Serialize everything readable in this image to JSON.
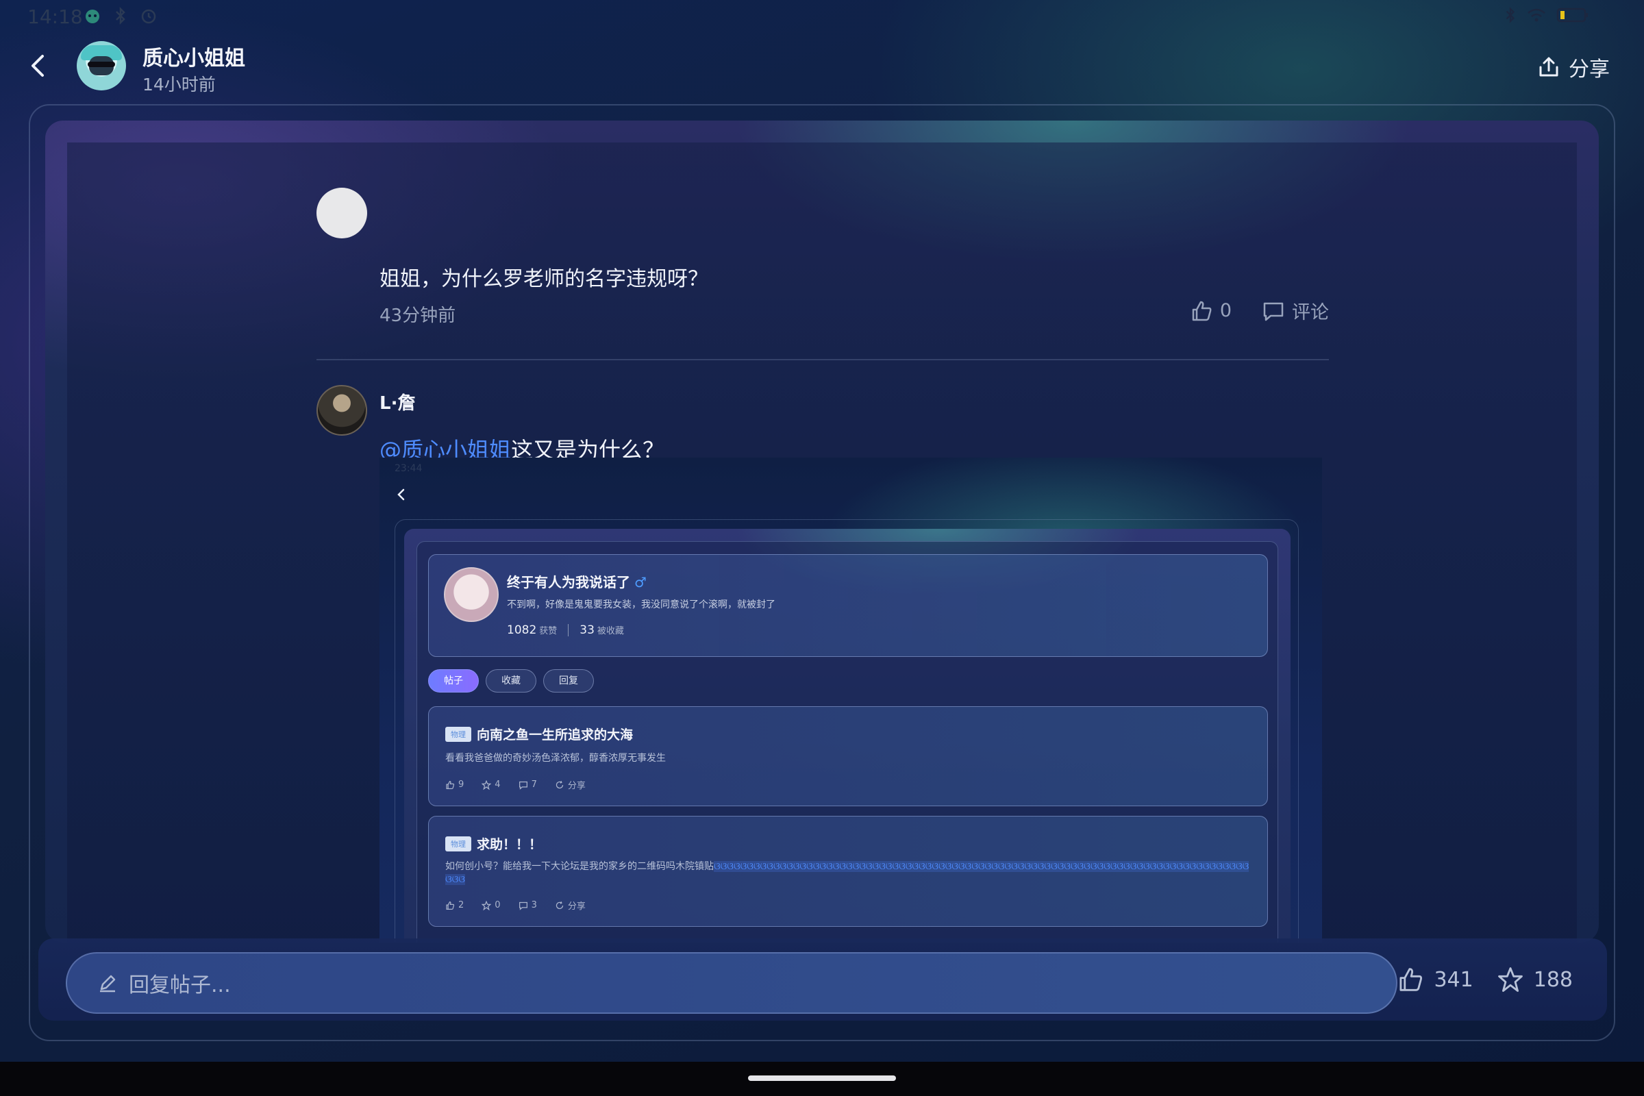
{
  "status_bar": {
    "time": "14:18"
  },
  "header": {
    "author_name": "质心小姐姐",
    "post_time": "14小时前",
    "share_label": "分享"
  },
  "comments": [
    {
      "text": "姐姐，为什么罗老师的名字违规呀？",
      "time": "43分钟前",
      "like_count": "0",
      "comment_label": "评论"
    },
    {
      "author": "L·詹",
      "mention": "@质心小姐姐",
      "text": "这又是为什么？"
    }
  ],
  "embedded_screenshot": {
    "status_time": "23:44",
    "profile": {
      "name": "终于有人为我说话了",
      "gender_symbol": "♂",
      "bio": "不到啊，好像是鬼鬼要我女装，我没同意说了个滚啊，就被封了",
      "likes_count": "1082",
      "likes_label": "获赞",
      "favorites_count": "33",
      "favorites_label": "被收藏"
    },
    "tabs": [
      "帖子",
      "收藏",
      "回复"
    ],
    "posts": [
      {
        "tag": "物理",
        "title": "向南之鱼一生所追求的大海",
        "body": "看看我爸爸做的奇妙汤色泽浓郁，醇香浓厚无事发生",
        "likes": "9",
        "stars": "4",
        "comments": "7",
        "share_label": "分享"
      },
      {
        "tag": "物理",
        "title": "求助！！！",
        "body": "如何创小号？能给我一下大论坛是我的家乡的二维码吗木院镇贴",
        "body_highlight": "ଓଓଓଓଓଓଓଓଓଓଓଓଓଓଓଓଓଓଓଓଓଓଓଓଓଓଓଓଓଓଓଓଓଓଓଓଓଓଓଓଓଓଓଓଓଓଓଓଓଓଓଓଓଓଓଓଓଓଓଓଓଓଓଓଓଓଓଓଓଓଓଓଓଓଓଓଓଓଓଓଓଓଓଓ",
        "likes": "2",
        "stars": "0",
        "comments": "3",
        "share_label": "分享"
      }
    ]
  },
  "reply_bar": {
    "placeholder": "回复帖子...",
    "like_count": "341",
    "favorite_count": "188"
  },
  "colors": {
    "mention": "#4e8cff",
    "active_tab": "#7a74ff",
    "background": "#102040"
  },
  "icons": [
    "back-arrow-icon",
    "share-icon",
    "thumbs-up-icon",
    "comment-icon",
    "star-icon",
    "pencil-icon",
    "bluetooth-icon",
    "wifi-icon",
    "battery-icon",
    "alarm-icon"
  ]
}
